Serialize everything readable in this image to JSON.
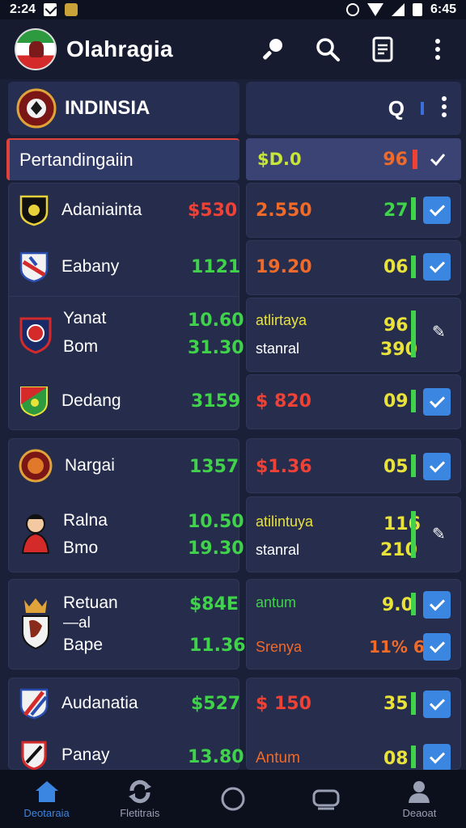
{
  "status": {
    "time_left": "2:24",
    "time_right": "6:45"
  },
  "app": {
    "title": "Olahragia"
  },
  "section": {
    "title": "INDINSIA",
    "right_q": "Q"
  },
  "pertandingan": {
    "label": "Pertandingaiin",
    "value": "$D.0",
    "count": "96"
  },
  "rows": [
    {
      "name": "Adaniainta",
      "val": "$530",
      "odds": "2.550",
      "count": "27"
    },
    {
      "name": "Eabany",
      "val": "1121",
      "odds": "19.20",
      "count": "06"
    },
    {
      "name": "Yanat",
      "name2": "Bom",
      "val": "10.60",
      "val2": "31.30",
      "label": "atlirtaya",
      "label2": "stanral",
      "count": "96",
      "count2": "390"
    },
    {
      "name": "Dedang",
      "val": "3159",
      "odds": "$ 820",
      "count": "09"
    },
    {
      "name": "Nargai",
      "val": "1357",
      "odds": "$1.36",
      "count": "05"
    },
    {
      "name": "Ralna",
      "name2": "Bmo",
      "val": "10.50",
      "val2": "19.30",
      "label": "atilintuya",
      "label2": "stanral",
      "count": "116",
      "count2": "210"
    },
    {
      "name": "Retuan",
      "sub": "—al",
      "name2": "Bape",
      "val": "$84E",
      "val2": "11.36",
      "label": "antum",
      "label2": "Srenya",
      "count": "9.0",
      "count2": "11% 6"
    },
    {
      "name": "Audanatia",
      "val": "$527",
      "odds": "$ 150",
      "count": "35"
    },
    {
      "name": "Panay",
      "val": "13.80",
      "odds": "Antum",
      "count": "08"
    }
  ],
  "nav": [
    {
      "label": "Deotaraia",
      "icon": "home-icon"
    },
    {
      "label": "Fletitrais",
      "icon": "refresh-icon"
    },
    {
      "label": "",
      "icon": "circle-icon"
    },
    {
      "label": "",
      "icon": "tv-icon"
    },
    {
      "label": "Deaoat",
      "icon": "profile-icon"
    }
  ],
  "colors": {
    "accent": "#3b86e0",
    "green": "#3fd24a",
    "red": "#ee4236",
    "bg": "#1a2038"
  }
}
